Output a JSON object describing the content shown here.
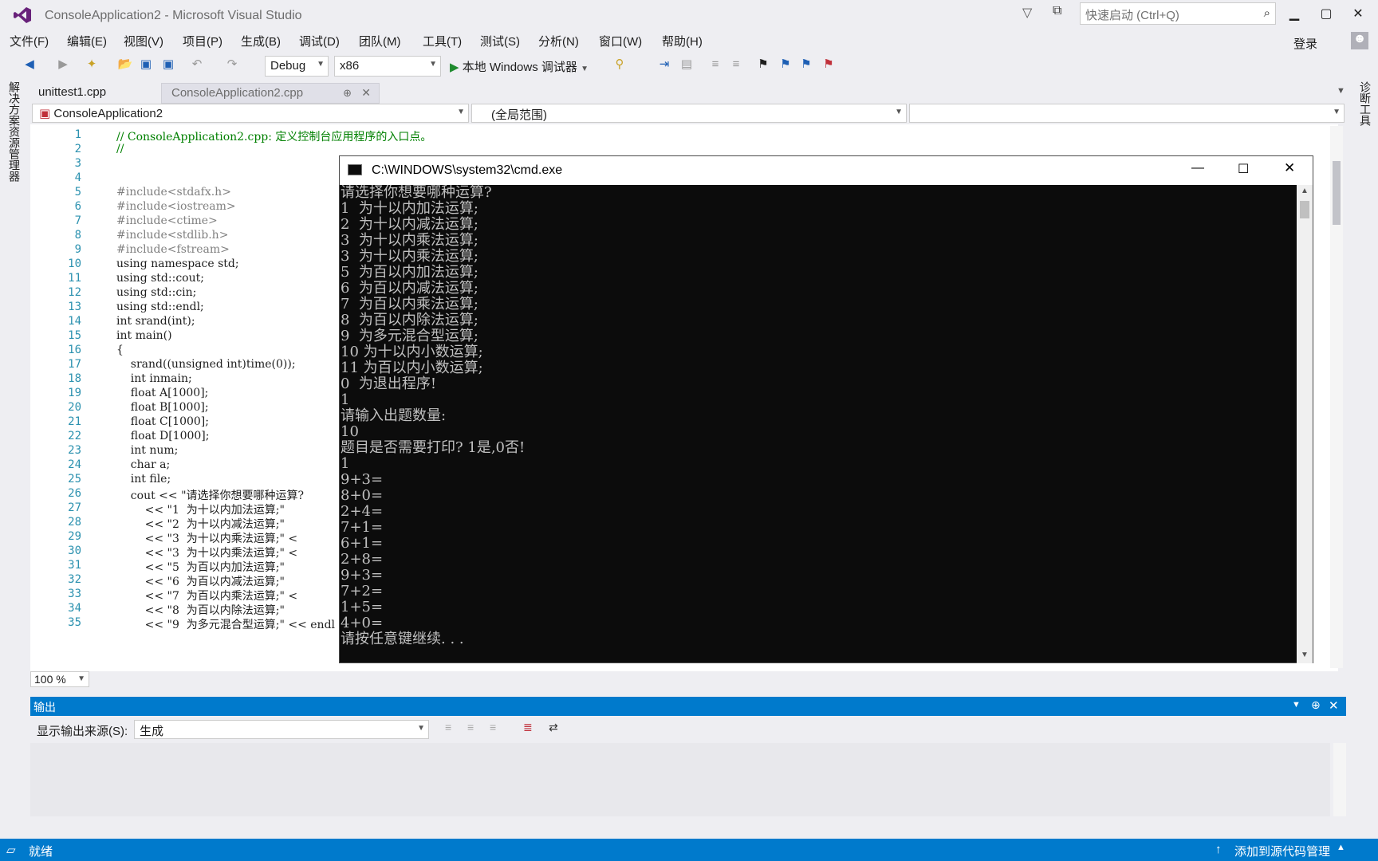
{
  "window": {
    "title": "ConsoleApplication2 - Microsoft Visual Studio",
    "quick_launch_placeholder": "快速启动 (Ctrl+Q)",
    "signin": "登录"
  },
  "menu": [
    "文件(F)",
    "编辑(E)",
    "视图(V)",
    "项目(P)",
    "生成(B)",
    "调试(D)",
    "团队(M)",
    "工具(T)",
    "测试(S)",
    "分析(N)",
    "窗口(W)",
    "帮助(H)"
  ],
  "toolbar": {
    "config": "Debug",
    "platform": "x86",
    "run_label": "本地 Windows 调试器"
  },
  "left_tab": "解决方案资源管理器",
  "right_tab": "诊断工具",
  "tabs": [
    {
      "label": "unittest1.cpp"
    },
    {
      "label": "ConsoleApplication2.cpp"
    }
  ],
  "nav": {
    "project": "ConsoleApplication2",
    "scope": "(全局范围)",
    "member": ""
  },
  "editor": {
    "line_numbers": [
      "1",
      "2",
      "3",
      "4",
      "5",
      "6",
      "7",
      "8",
      "9",
      "10",
      "11",
      "12",
      "13",
      "14",
      "15",
      "16",
      "17",
      "18",
      "19",
      "20",
      "21",
      "22",
      "23",
      "24",
      "25",
      "26",
      "27",
      "28",
      "29",
      "30",
      "31",
      "32",
      "33",
      "34",
      "35"
    ],
    "lines": [
      "// ConsoleApplication2.cpp: 定义控制台应用程序的入口点。",
      "//",
      "",
      "",
      "#include<stdafx.h>",
      "#include<iostream>",
      "#include<ctime>",
      "#include<stdlib.h>",
      "#include<fstream>",
      "using namespace std;",
      "using std::cout;",
      "using std::cin;",
      "using std::endl;",
      "int srand(int);",
      "int main()",
      "{",
      "    srand((unsigned int)time(0));",
      "    int inmain;",
      "    float A[1000];",
      "    float B[1000];",
      "    float C[1000];",
      "    float D[1000];",
      "    int num;",
      "    char a;",
      "    int file;",
      "    cout << \"请选择你想要哪种运算?",
      "        << \"1  为十以内加法运算;\"",
      "        << \"2  为十以内减法运算;\"",
      "        << \"3  为十以内乘法运算;\" <",
      "        << \"3  为十以内乘法运算;\" <",
      "        << \"5  为百以内加法运算;\"",
      "        << \"6  为百以内减法运算;\"",
      "        << \"7  为百以内乘法运算;\" <",
      "        << \"8  为百以内除法运算;\"",
      "        << \"9  为多元混合型运算;\" << endl"
    ],
    "zoom": "100 %"
  },
  "cmd": {
    "title": "C:\\WINDOWS\\system32\\cmd.exe",
    "output": "请选择你想要哪种运算?\n1  为十以内加法运算;\n2  为十以内减法运算;\n3  为十以内乘法运算;\n3  为十以内乘法运算;\n5  为百以内加法运算;\n6  为百以内减法运算;\n7  为百以内乘法运算;\n8  为百以内除法运算;\n9  为多元混合型运算;\n10 为十以内小数运算;\n11 为百以内小数运算;\n0  为退出程序!\n1\n请输入出题数量:\n10\n题目是否需要打印? 1是,0否!\n1\n9+3=\n8+0=\n2+4=\n7+1=\n6+1=\n2+8=\n9+3=\n7+2=\n1+5=\n4+0=\n请按任意键继续. . ."
  },
  "output_panel": {
    "title": "输出",
    "source_label": "显示输出来源(S):",
    "source_value": "生成"
  },
  "status": {
    "left": "就绪",
    "right": "添加到源代码管理"
  },
  "colors": {
    "accent": "#007acc",
    "line_number": "#2b91af",
    "keyword": "#0000ff",
    "comment": "#008000",
    "string": "#a31515"
  }
}
